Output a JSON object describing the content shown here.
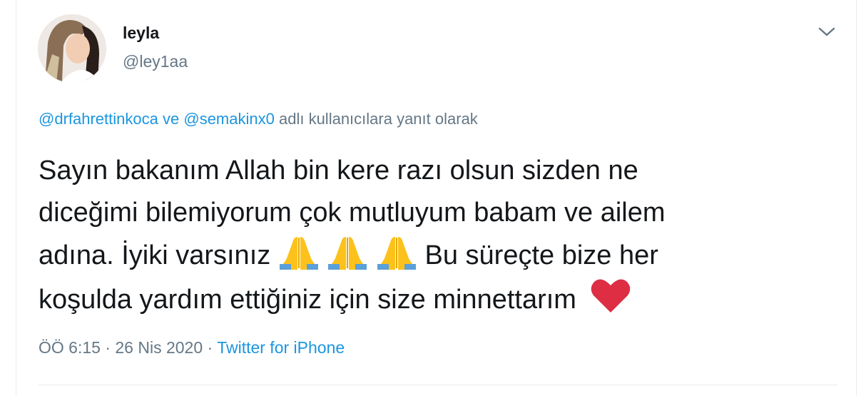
{
  "author": {
    "name": "leyla",
    "handle": "@ley1aa"
  },
  "reply_context": {
    "user1": "@drfahrettinkoca",
    "conjunction": "ve",
    "user2": "@semakinx0",
    "suffix": "adlı kullanıcılara yanıt olarak"
  },
  "tweet": {
    "line1": "Sayın bakanım Allah bin kere razı olsun sizden ne",
    "line2": "diceğimi bilemiyorum çok mutluyum babam ve ailem",
    "line3a": "adına. İyiki varsınız",
    "line3b": "Bu süreçte bize her",
    "line4": "koşulda yardım ettiğiniz için size minnettarım"
  },
  "emoji_icons": [
    "praying-hands-icon",
    "praying-hands-icon",
    "praying-hands-icon",
    "red-heart-icon"
  ],
  "meta": {
    "time": "ÖÖ 6:15",
    "sep1": "·",
    "date": "26 Nis 2020",
    "sep2": "·",
    "source": "Twitter for iPhone"
  },
  "colors": {
    "link": "#1b95e0",
    "secondary_text": "#657786",
    "primary_text": "#14171a",
    "heart": "#dd2e44",
    "emoji_hands": "#fcc21b"
  }
}
